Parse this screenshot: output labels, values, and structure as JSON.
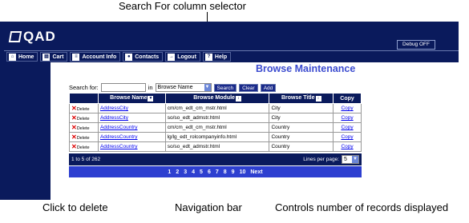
{
  "callouts": {
    "top": "Search For column selector",
    "delete": "Click to delete",
    "navbar": "Navigation bar",
    "records": "Controls number of records displayed"
  },
  "brand": "QAD",
  "debug_label": "Debug OFF",
  "nav": [
    {
      "label": "Home",
      "icon": "home-icon"
    },
    {
      "label": "Cart",
      "icon": "cart-icon"
    },
    {
      "label": "Account Info",
      "icon": "account-icon"
    },
    {
      "label": "Contacts",
      "icon": "contacts-icon"
    },
    {
      "label": "Logout",
      "icon": "logout-icon"
    },
    {
      "label": "Help",
      "icon": "help-icon"
    }
  ],
  "page_title": "Browse Maintenance",
  "search": {
    "label": "Search for:",
    "value": "",
    "in_label": "in",
    "column": "Browse Name",
    "search_btn": "Search",
    "clear_btn": "Clear",
    "add_btn": "Add"
  },
  "table": {
    "headers": [
      "",
      "Browse Name",
      "Browse Module",
      "Browse Title",
      "Copy"
    ],
    "delete_label": "Delete",
    "rows": [
      {
        "name": "AddressCity",
        "module": "cm/cm_edt_cm_mstr.html",
        "title": "City",
        "copy": "Copy"
      },
      {
        "name": "AddressCity",
        "module": "so/so_edt_admstr.html",
        "title": "City",
        "copy": "Copy"
      },
      {
        "name": "AddressCountry",
        "module": "cm/cm_edt_cm_mstr.html",
        "title": "Country",
        "copy": "Copy"
      },
      {
        "name": "AddressCountry",
        "module": "lg/lg_edt_rolcompanyinfo.html",
        "title": "Country",
        "copy": "Copy"
      },
      {
        "name": "AddressCountry",
        "module": "so/so_edt_admstr.html",
        "title": "Country",
        "copy": "Copy"
      }
    ]
  },
  "footer": {
    "range": "1 to 5 of 262",
    "per_page_label": "Lines per page:",
    "per_page": "5"
  },
  "pagination": {
    "pages": [
      "1",
      "2",
      "3",
      "4",
      "5",
      "6",
      "7",
      "8",
      "9",
      "10"
    ],
    "next": "Next"
  },
  "colors": {
    "frame": "#0a1a5c",
    "title": "#3b4bcf",
    "pagebar": "#2d3fd0"
  }
}
